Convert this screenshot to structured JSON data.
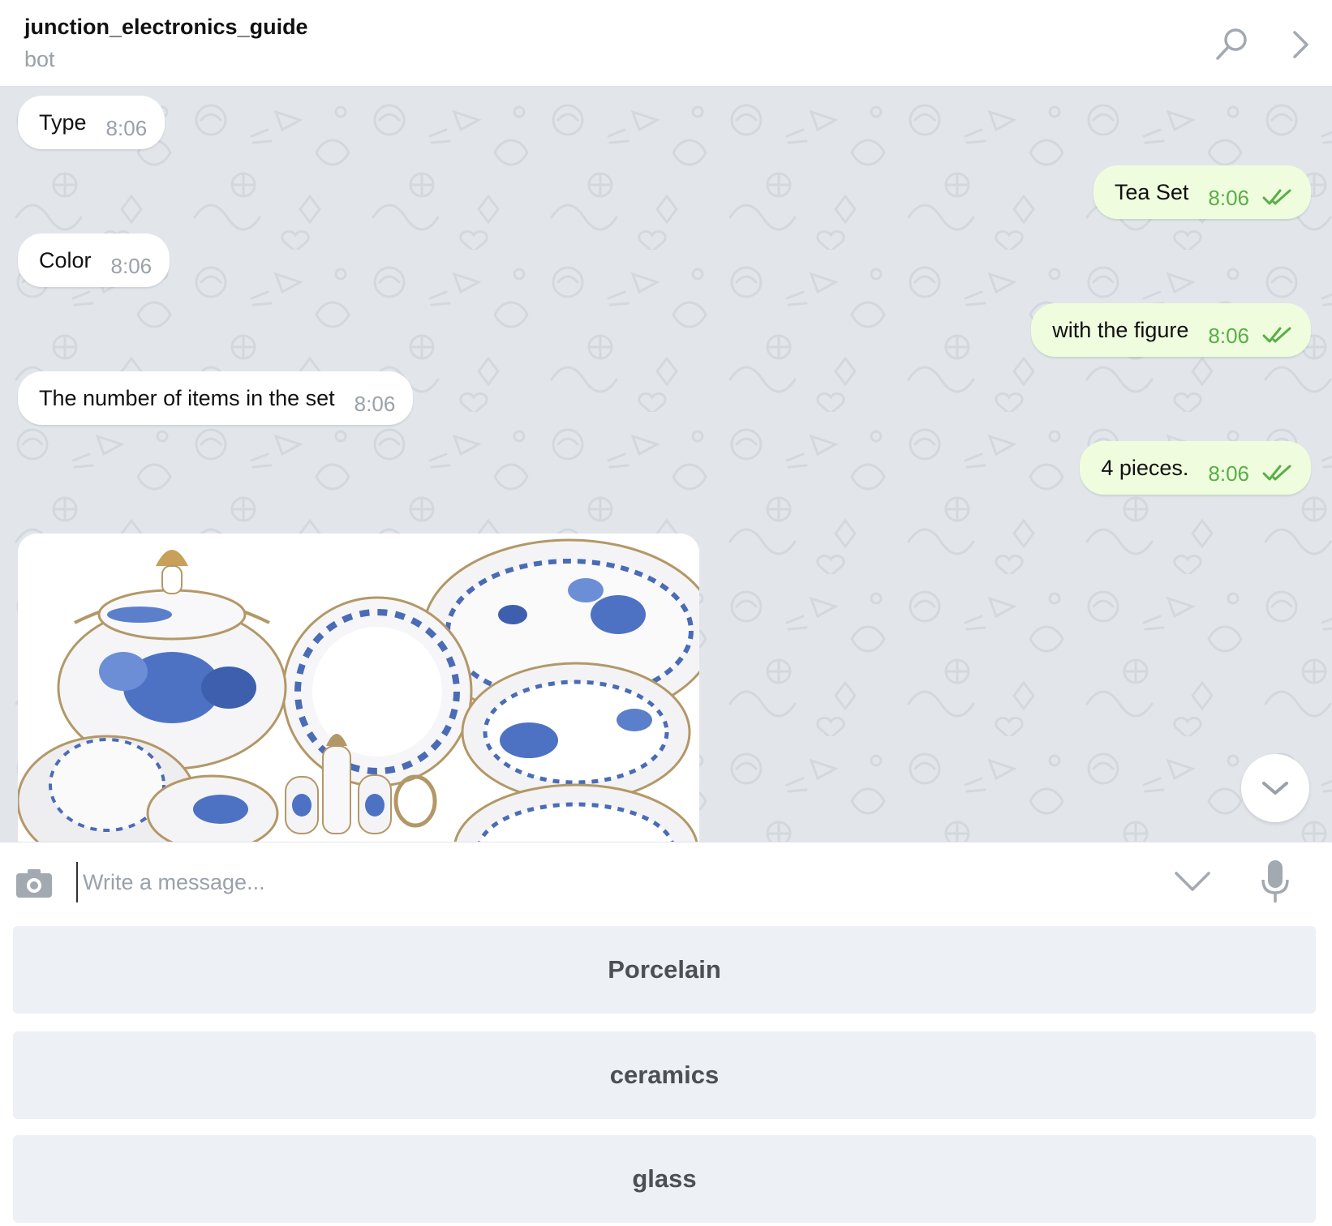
{
  "header": {
    "title": "junction_electronics_guide",
    "subtitle": "bot",
    "icons": [
      "search-icon",
      "chevron-right-icon"
    ]
  },
  "messages": [
    {
      "direction": "incoming",
      "text": "Type",
      "time": "8:06"
    },
    {
      "direction": "outgoing",
      "text": "Tea Set",
      "time": "8:06",
      "status": "read"
    },
    {
      "direction": "incoming",
      "text": "Color",
      "time": "8:06"
    },
    {
      "direction": "outgoing",
      "text": "with the figure",
      "time": "8:06",
      "status": "read"
    },
    {
      "direction": "incoming",
      "text": "The number of items in the set",
      "time": "8:06"
    },
    {
      "direction": "outgoing",
      "text": "4 pieces.",
      "time": "8:06",
      "status": "read"
    },
    {
      "direction": "incoming",
      "type": "photo",
      "subject": "blue-floral-porcelain-tableware"
    }
  ],
  "composer": {
    "placeholder": "Write a message...",
    "value": "",
    "icons": [
      "camera-icon",
      "keyboard-toggle-icon",
      "microphone-icon"
    ]
  },
  "reply_keyboard": {
    "buttons": [
      {
        "label": "Porcelain"
      },
      {
        "label": "ceramics"
      },
      {
        "label": "glass"
      }
    ]
  },
  "colors": {
    "chat_background": "#e2e6eb",
    "incoming_bubble": "#ffffff",
    "outgoing_bubble": "#effdde",
    "outgoing_time": "#59ae48",
    "incoming_time": "#9aa1a9",
    "keyboard_button": "#edf0f4",
    "keyboard_text": "#4b5056"
  }
}
